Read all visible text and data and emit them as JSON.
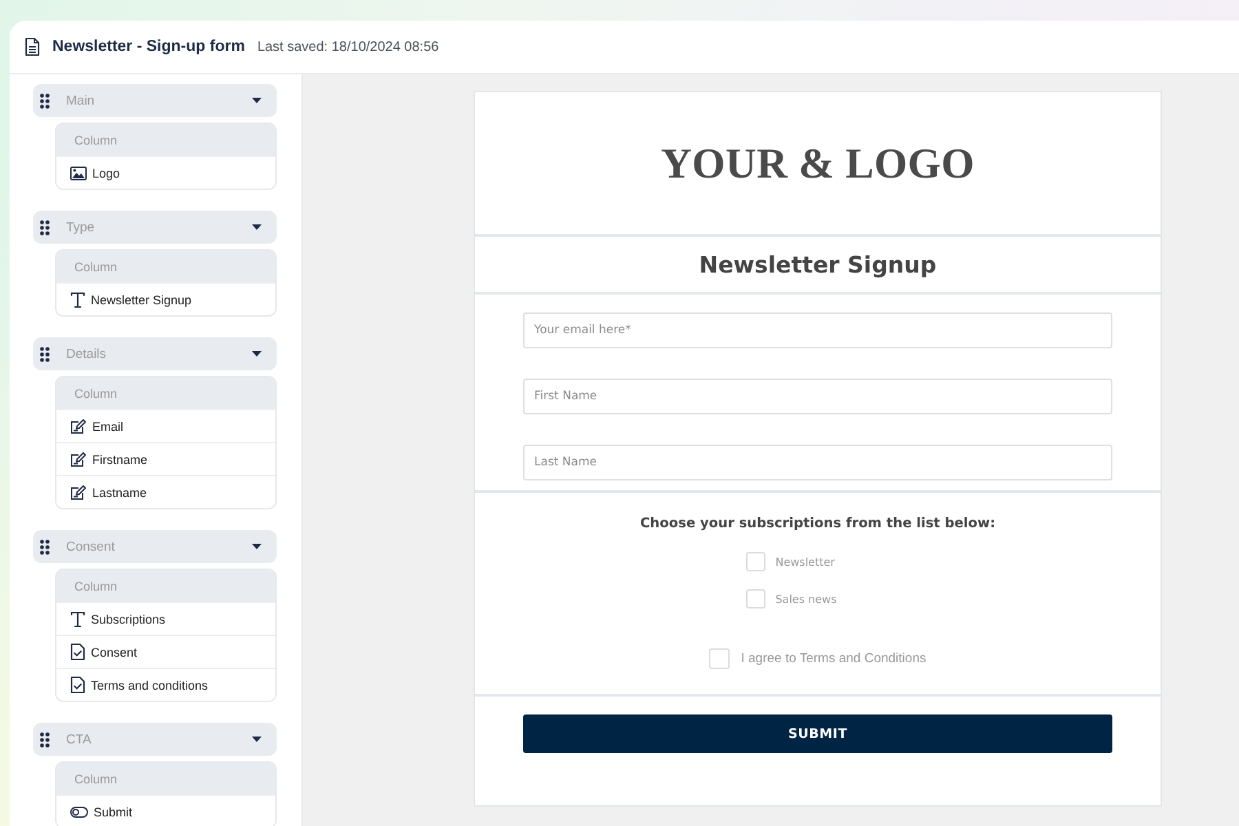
{
  "header": {
    "title": "Newsletter - Sign-up form",
    "last_saved": "Last saved: 18/10/2024 08:56"
  },
  "sidebar": {
    "sections": [
      {
        "label": "Main",
        "expanded": true,
        "column": {
          "label": "Column",
          "items": [
            {
              "kind": "image",
              "label": "Logo"
            }
          ]
        }
      },
      {
        "label": "Type",
        "expanded": true,
        "column": {
          "label": "Column",
          "items": [
            {
              "kind": "text",
              "label": "Newsletter Signup"
            }
          ]
        }
      },
      {
        "label": "Details",
        "expanded": true,
        "column": {
          "label": "Column",
          "items": [
            {
              "kind": "input",
              "label": "Email"
            },
            {
              "kind": "input",
              "label": "Firstname"
            },
            {
              "kind": "input",
              "label": "Lastname"
            }
          ]
        }
      },
      {
        "label": "Consent",
        "expanded": true,
        "column": {
          "label": "Column",
          "items": [
            {
              "kind": "text",
              "label": "Subscriptions"
            },
            {
              "kind": "checkbox",
              "label": "Consent"
            },
            {
              "kind": "checkbox",
              "label": "Terms and conditions"
            }
          ]
        }
      },
      {
        "label": "CTA",
        "expanded": true,
        "column": {
          "label": "Column",
          "items": [
            {
              "kind": "button",
              "label": "Submit"
            }
          ]
        }
      }
    ]
  },
  "form": {
    "logo": "YOUR & LOGO",
    "title": "Newsletter Signup",
    "fields": [
      {
        "placeholder": "Your email here*"
      },
      {
        "placeholder": "First Name"
      },
      {
        "placeholder": "Last Name"
      }
    ],
    "subscriptions": {
      "heading": "Choose your subscriptions from the list below:",
      "options": [
        {
          "label": "Newsletter",
          "checked": false
        },
        {
          "label": "Sales news",
          "checked": false
        }
      ]
    },
    "consent": {
      "label": "I agree to Terms and Conditions",
      "checked": false
    },
    "submit": "SUBMIT"
  }
}
